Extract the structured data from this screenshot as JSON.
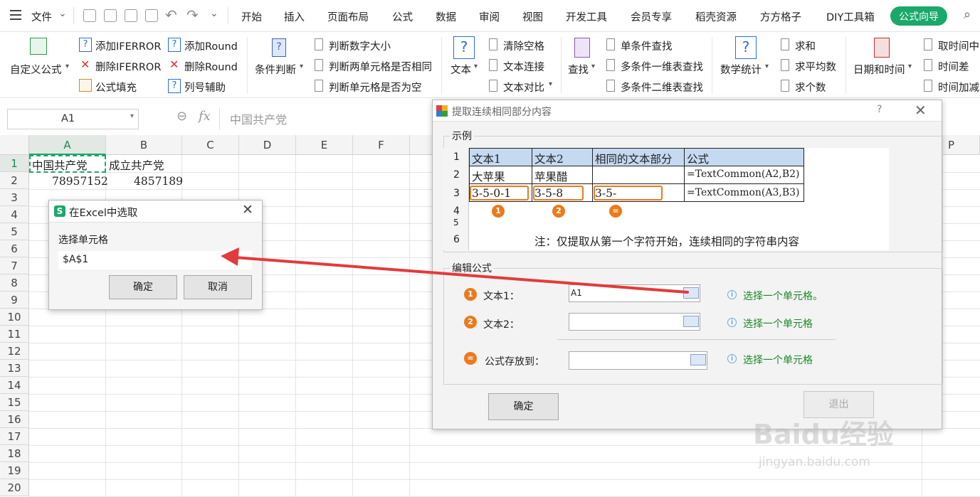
{
  "menubar": {
    "file": "文件",
    "tabs": [
      "开始",
      "插入",
      "页面布局",
      "公式",
      "数据",
      "审阅",
      "视图",
      "开发工具",
      "会员专享",
      "稻壳资源",
      "方方格子",
      "DIY工具箱"
    ],
    "active_tab": "公式向导",
    "active_color": "#1aa86b"
  },
  "ribbon": {
    "custom_formula": "自定义公式",
    "add_iferror": "添加IFERROR",
    "del_iferror": "删除IFERROR",
    "formula_fill": "公式填充",
    "add_round": "添加Round",
    "del_round": "删除Round",
    "col_assist": "列号辅助",
    "condition": "条件判断",
    "judge_size": "判断数字大小",
    "judge_same": "判断两单元格是否相同",
    "judge_empty": "判断单元格是否为空",
    "text": "文本",
    "clear_space": "清除空格",
    "text_join": "文本连接",
    "text_compare": "文本对比",
    "lookup": "查找",
    "single_lookup": "单条件查找",
    "multi_1d": "多条件一维表查找",
    "multi_2d": "多条件二维表查找",
    "math_stats": "数学统计",
    "sum": "求和",
    "avg": "求平均数",
    "count": "求个数",
    "datetime": "日期和时间",
    "get_time": "取时间中",
    "time_diff": "时间差",
    "time_add": "时间加减"
  },
  "formula_bar": {
    "name_box": "A1",
    "fx": "fx",
    "content": "中国共产党"
  },
  "sheet": {
    "columns": [
      "A",
      "B",
      "C",
      "D",
      "E",
      "F",
      "P"
    ],
    "rows": [
      "1",
      "2",
      "3",
      "4",
      "5",
      "6",
      "7",
      "8",
      "9",
      "10",
      "11",
      "12",
      "13",
      "14",
      "15",
      "16",
      "17",
      "18",
      "19",
      "20"
    ],
    "a1": "中国共产党",
    "b1": "成立共产党",
    "a2": "78957152",
    "b2": "4857189"
  },
  "pick_dialog": {
    "title": "在Excel中选取",
    "label": "选择单元格",
    "value": "$A$1",
    "ok": "确定",
    "cancel": "取消"
  },
  "main_dialog": {
    "title": "提取连续相同部分内容",
    "help": "?",
    "example_label": "示例",
    "example": {
      "headers": [
        "文本1",
        "文本2",
        "相同的文本部分",
        "公式"
      ],
      "row2": [
        "大苹果",
        "苹果醋",
        "",
        "=TextCommon(A2,B2)"
      ],
      "row3": [
        "3-5-0-1",
        "3-5-8",
        "3-5-",
        "=TextCommon(A3,B3)"
      ],
      "rownums": [
        "1",
        "2",
        "3",
        "4",
        "5",
        "6"
      ],
      "badges": [
        "1",
        "2",
        "="
      ],
      "note": "注：仅提取从第一个字符开始，连续相同的字符串内容"
    },
    "edit_label": "编辑公式",
    "fields": [
      {
        "badge": "1",
        "label": "文本1：",
        "value": "A1",
        "hint": "选择一个单元格。"
      },
      {
        "badge": "2",
        "label": "文本2：",
        "value": "",
        "hint": "选择一个单元格"
      },
      {
        "badge": "=",
        "label": "公式存放到：",
        "value": "",
        "hint": "选择一个单元格"
      }
    ],
    "ok": "确定",
    "exit": "退出"
  },
  "watermark": {
    "brand": "Baidu经验",
    "url": "jingyan.baidu.com"
  }
}
